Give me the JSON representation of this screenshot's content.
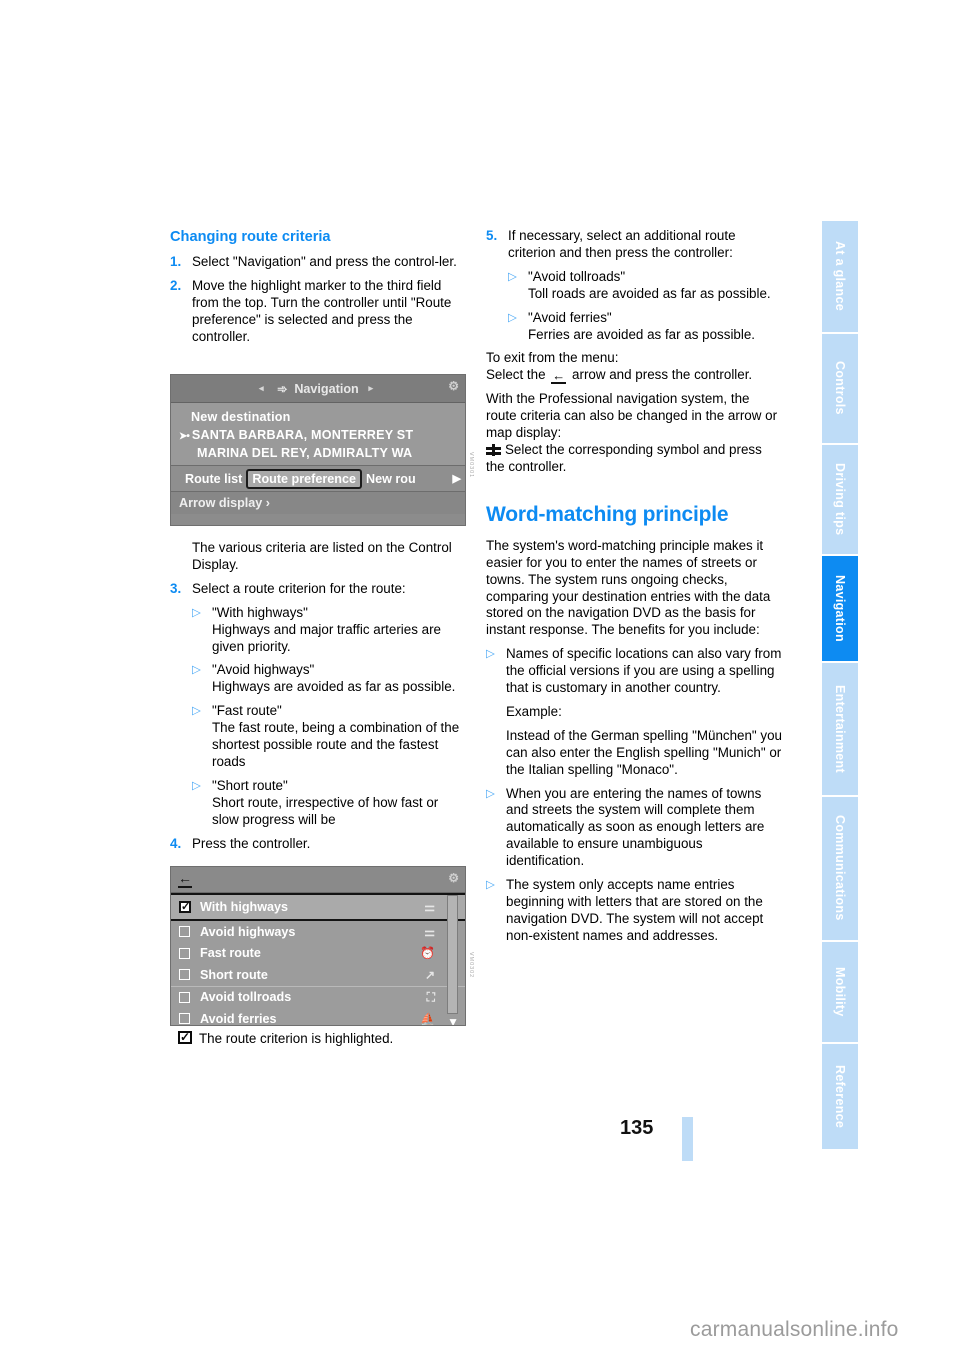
{
  "document": {
    "page_number": "135",
    "watermark": "carmanualsonline.info"
  },
  "sidebar": {
    "tabs": [
      {
        "label": "At a glance",
        "active": false
      },
      {
        "label": "Controls",
        "active": false
      },
      {
        "label": "Driving tips",
        "active": false
      },
      {
        "label": "Navigation",
        "active": true
      },
      {
        "label": "Entertainment",
        "active": false
      },
      {
        "label": "Communications",
        "active": false
      },
      {
        "label": "Mobility",
        "active": false
      },
      {
        "label": "Reference",
        "active": false
      }
    ],
    "active_color": "#0d8bf2",
    "inactive_color": "#bedcf7"
  },
  "left_column": {
    "heading": "Changing route criteria",
    "step1_num": "1.",
    "step1_text": "Select \"Navigation\" and press the control-ler.",
    "step2_num": "2.",
    "step2_text": "Move the highlight marker to the third field from the top. Turn the controller until \"Route preference\" is selected and press the controller.",
    "after_image_text": "The various criteria are listed on the Control Display.",
    "step3_num": "3.",
    "step3_text": "Select a route criterion for the route:",
    "criteria": [
      {
        "title": "\"With highways\"",
        "desc": "Highways and major traffic arteries are given priority."
      },
      {
        "title": "\"Avoid highways\"",
        "desc": "Highways are avoided as far as possible."
      },
      {
        "title": "\"Fast route\"",
        "desc": "The fast route, being a combination of the shortest possible route and the fastest roads"
      },
      {
        "title": "\"Short route\"",
        "desc": "Short route, irrespective of how fast or slow progress will be"
      }
    ],
    "step4_num": "4.",
    "step4_text": "Press the controller.",
    "note_text": "The route criterion is highlighted.",
    "note_icon": "checked-checkbox-icon"
  },
  "right_column": {
    "step5_num": "5.",
    "step5_text": "If necessary, select an additional route criterion and then press the controller:",
    "criteria": [
      {
        "title": "\"Avoid tollroads\"",
        "desc": "Toll roads are avoided as far as possible."
      },
      {
        "title": "\"Avoid ferries\"",
        "desc": "Ferries are avoided as far as possible."
      }
    ],
    "exit_intro": "To exit from the menu:",
    "exit_text_before": "Select the",
    "exit_icon": "back-arrow-icon",
    "exit_text_after": "arrow and press the controller.",
    "professional_text": "With the Professional navigation system, the route criteria can also be changed in the arrow or map display:",
    "symbol_icon": "highway-symbol-icon",
    "symbol_text": "Select the corresponding symbol and press the controller.",
    "heading2": "Word-matching principle",
    "intro": "The system's word-matching principle makes it easier for you to enter the names of streets or towns. The system runs ongoing checks, comparing your destination entries with the data stored on the navigation DVD as the basis for instant response. The benefits for you include:",
    "benefits": [
      {
        "text": "Names of specific locations can also vary from the official versions if you are using a spelling that is customary in another country.",
        "example_label": "Example:",
        "example_text": "Instead of the German spelling \"München\" you can also enter the English spelling \"Munich\" or the Italian spelling \"Monaco\"."
      },
      {
        "text": "When you are entering the names of towns and streets the system will complete them automatically as soon as enough letters are available to ensure unambiguous identification."
      },
      {
        "text": "The system only accepts name entries beginning with letters that are stored on the navigation DVD. The system will not accept non-existent names and addresses."
      }
    ]
  },
  "nav_screenshot_top": {
    "title": "Navigation",
    "title_icon": "navigation-pin-icon",
    "corner_icon": "expand-icon",
    "arrow_left": "◂",
    "arrow_right": "▸",
    "line1": "New destination",
    "line2": "SANTA BARBARA, MONTERREY ST",
    "line3": "MARINA DEL REY, ADMIRALTY WA",
    "buttons": [
      {
        "label": "Route list",
        "selected": false
      },
      {
        "label": "Route preference",
        "selected": true
      },
      {
        "label": "New rou",
        "selected": false
      }
    ],
    "scroll_icon": "▶",
    "footer": "Arrow display  ›",
    "figure_code": "VM0301"
  },
  "nav_screenshot_bottom": {
    "back_icon": "back-arrow-icon",
    "corner_icon": "expand-icon",
    "rows": [
      {
        "label": "With highways",
        "checked": true,
        "icon": "highway-icon"
      },
      {
        "label": "Avoid highways",
        "checked": false,
        "icon": "no-highway-icon"
      },
      {
        "label": "Fast route",
        "checked": false,
        "icon": "clock-icon"
      },
      {
        "label": "Short route",
        "checked": false,
        "icon": "short-route-icon"
      },
      {
        "label": "Avoid tollroads",
        "checked": false,
        "icon": "tollroad-icon"
      },
      {
        "label": "Avoid ferries",
        "checked": false,
        "icon": "ferry-icon"
      }
    ],
    "scroll_down_icon": "▼",
    "figure_code": "VM0302"
  }
}
